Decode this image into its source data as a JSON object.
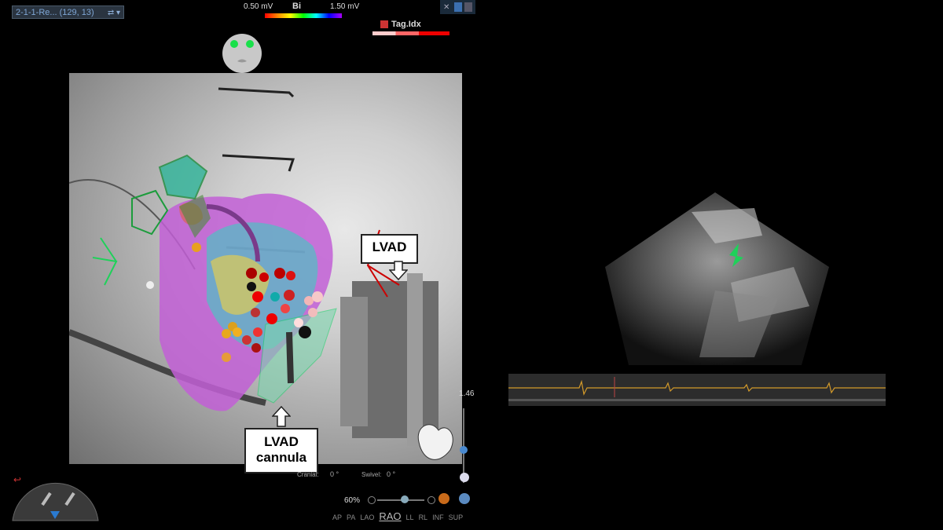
{
  "session": {
    "label": "2-1-1-Re... (129, 13)"
  },
  "color_scale": {
    "min": "0.50 mV",
    "max": "1.50 mV",
    "mode": "Bi"
  },
  "tag": {
    "label": "Tag.Idx"
  },
  "annotations": {
    "lvad": "LVAD",
    "cannula_line1": "LVAD",
    "cannula_line2": "cannula"
  },
  "view_controls": {
    "zoom": "60%",
    "views": [
      "AP",
      "PA",
      "LAO",
      "RAO",
      "LL",
      "RL",
      "INF",
      "SUP"
    ],
    "active_view": "RAO",
    "cranial_label": "Cranial:",
    "cranial_value": "0 °",
    "swivel_label": "Swivel:",
    "swivel_value": "0 °",
    "side_value": "1.46"
  },
  "colors": {
    "accent_green": "#1fd15a",
    "scale_red": "#e00000"
  }
}
